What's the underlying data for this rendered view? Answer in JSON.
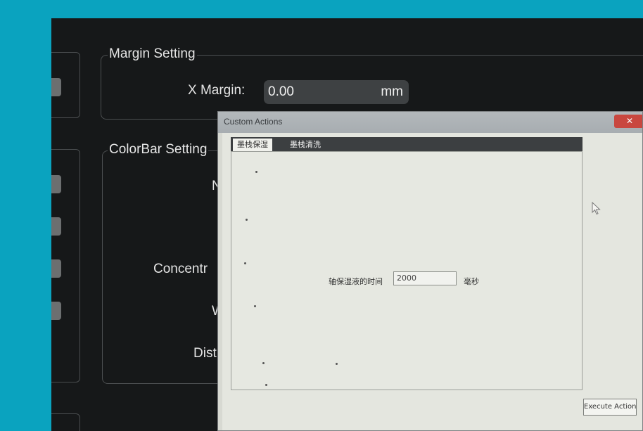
{
  "background_app": {
    "margin_setting": {
      "title": "Margin Setting",
      "x_margin_label": "X Margin:",
      "x_margin_value": "0.00",
      "x_margin_unit": "mm"
    },
    "colorbar_setting": {
      "title": "ColorBar Setting",
      "labels": [
        "N",
        "Concentr",
        "W",
        "Dist"
      ]
    }
  },
  "dialog": {
    "title": "Custom Actions",
    "close_label": "✕",
    "tabs": [
      "墨栈保湿",
      "墨栈清洗"
    ],
    "field_label": "轴保湿液的时间",
    "field_value": "2000",
    "field_unit": "毫秒",
    "execute_label": "Execute Action"
  },
  "colors": {
    "desk": "#0aa3bf",
    "app_bg": "#161819",
    "dialog_bg": "#e4e6df",
    "close_red": "#c9473f"
  }
}
